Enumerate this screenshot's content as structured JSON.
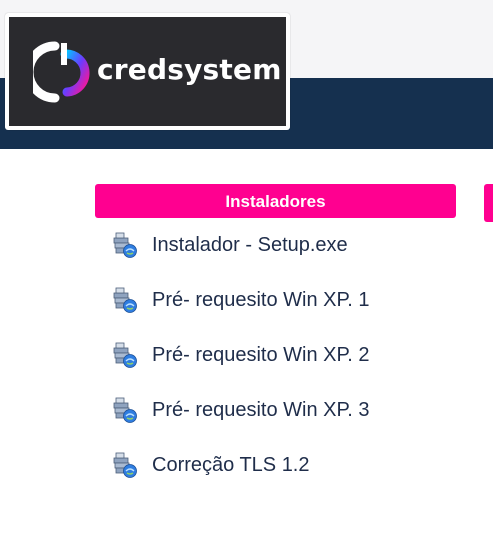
{
  "brand": {
    "name": "credsystem",
    "colors": {
      "dark": "#2a2a2e",
      "header": "#15304f",
      "accent": "#ff0090",
      "text": "#1f2d4a"
    }
  },
  "section": {
    "title": "Instaladores"
  },
  "downloads": [
    {
      "label": "Instalador - Setup.exe",
      "icon": "installer-icon"
    },
    {
      "label": "Pré- requesito Win XP. 1",
      "icon": "installer-icon"
    },
    {
      "label": "Pré- requesito Win XP. 2",
      "icon": "installer-icon"
    },
    {
      "label": "Pré- requesito Win XP. 3",
      "icon": "installer-icon"
    },
    {
      "label": "Correção TLS 1.2",
      "icon": "installer-icon"
    }
  ]
}
